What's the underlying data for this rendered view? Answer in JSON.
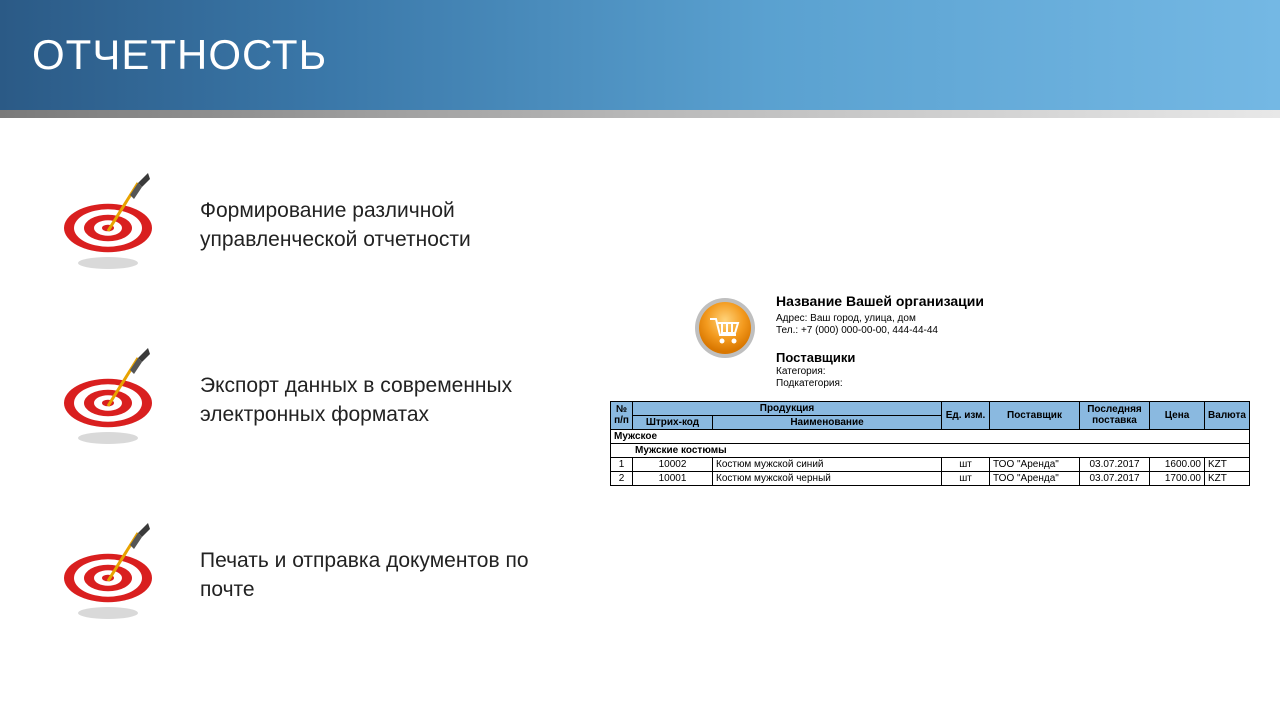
{
  "header": {
    "title": "ОТЧЕТНОСТЬ"
  },
  "bullets": [
    {
      "text": "Формирование различной управленческой отчетности"
    },
    {
      "text": "Экспорт данных в современных электронных форматах"
    },
    {
      "text": "Печать и отправка документов по почте"
    }
  ],
  "report": {
    "org_name": "Название Вашей организации",
    "address": "Адрес: Ваш город, улица, дом",
    "tel": "Тел.: +7 (000) 000-00-00, 444-44-44",
    "section_title": "Поставщики",
    "category_label": "Категория:",
    "subcategory_label": "Подкатегория:",
    "columns": {
      "num": "№ п/п",
      "product": "Продукция",
      "barcode": "Штрих-код",
      "name": "Наименование",
      "unit": "Ед. изм.",
      "supplier": "Поставщик",
      "last_delivery": "Последняя поставка",
      "price": "Цена",
      "currency": "Валюта"
    },
    "group1": "Мужское",
    "group2": "Мужские костюмы",
    "rows": [
      {
        "num": "1",
        "barcode": "10002",
        "name": "Костюм мужской синий",
        "unit": "шт",
        "supplier": "ТОО \"Аренда\"",
        "date": "03.07.2017",
        "price": "1600.00",
        "currency": "KZT"
      },
      {
        "num": "2",
        "barcode": "10001",
        "name": "Костюм мужской черный",
        "unit": "шт",
        "supplier": "ТОО \"Аренда\"",
        "date": "03.07.2017",
        "price": "1700.00",
        "currency": "KZT"
      }
    ]
  }
}
